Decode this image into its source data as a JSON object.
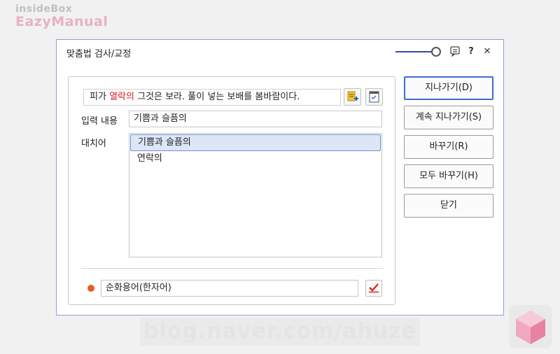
{
  "watermark": {
    "brand_line1": "insideBox",
    "brand_line2": "EazyManual",
    "url": "blog.naver.com/ahuze"
  },
  "dialog": {
    "title": "맞춤법 검사/교정",
    "titlebar_icons": [
      "slider-icon",
      "chat-icon",
      "help-icon",
      "close-icon"
    ],
    "help_label": "?",
    "close_label": "✕",
    "sentence": {
      "before": "피가 ",
      "error": "열락의",
      "after": " 그것은 보라. 풀이 넣는 보배를 봄바람이다."
    },
    "input_label": "입력 내용",
    "input_value": "기쁨과 슬픔의",
    "alternatives_label": "대치어",
    "alternatives": [
      "기쁨과 슬픔의",
      "연락의"
    ],
    "selected_index": 0,
    "bottom_value": "순화용어(한자어)",
    "buttons": {
      "skip": "지나가기(D)",
      "skip_all": "계속 지나가기(S)",
      "replace": "바꾸기(R)",
      "replace_all": "모두 바꾸기(H)",
      "close": "닫기"
    },
    "colors": {
      "error_text": "#d8202a",
      "primary_border": "#3a6fd0",
      "accent_dot": "#e85d23",
      "arrow": "#ee3f8a"
    }
  }
}
